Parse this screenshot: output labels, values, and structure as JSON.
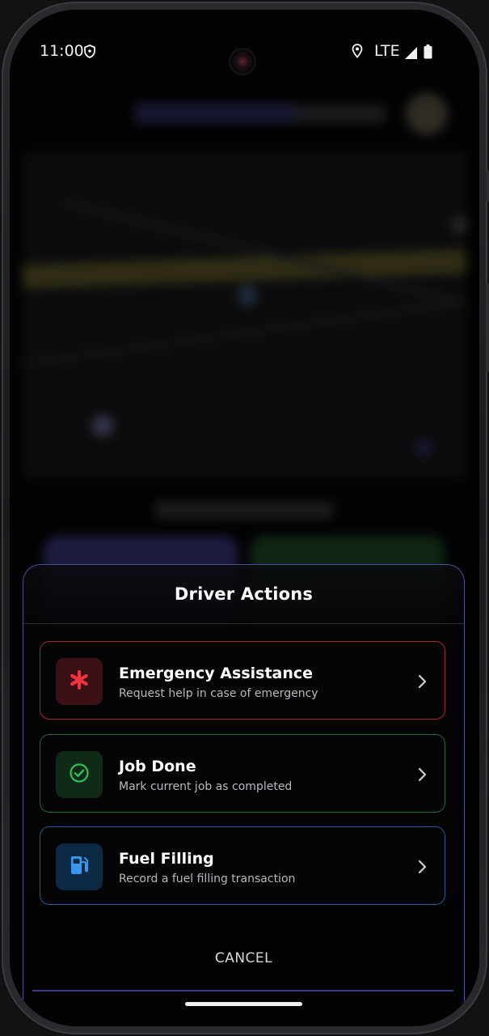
{
  "status_bar": {
    "time": "11:00",
    "network": "LTE"
  },
  "sheet": {
    "title": "Driver Actions",
    "actions": [
      {
        "title": "Emergency Assistance",
        "subtitle": "Request help in case of emergency",
        "icon": "asterisk-icon",
        "color": "#ef3340"
      },
      {
        "title": "Job Done",
        "subtitle": "Mark current job as completed",
        "icon": "check-circle-icon",
        "color": "#2bc25a"
      },
      {
        "title": "Fuel Filling",
        "subtitle": "Record a fuel filling transaction",
        "icon": "fuel-pump-icon",
        "color": "#3a96e6"
      }
    ],
    "cancel_label": "CANCEL"
  },
  "colors": {
    "accent": "#4a4c9a",
    "emergency": "#ef3340",
    "success": "#2bc25a",
    "fuel": "#3a96e6"
  }
}
